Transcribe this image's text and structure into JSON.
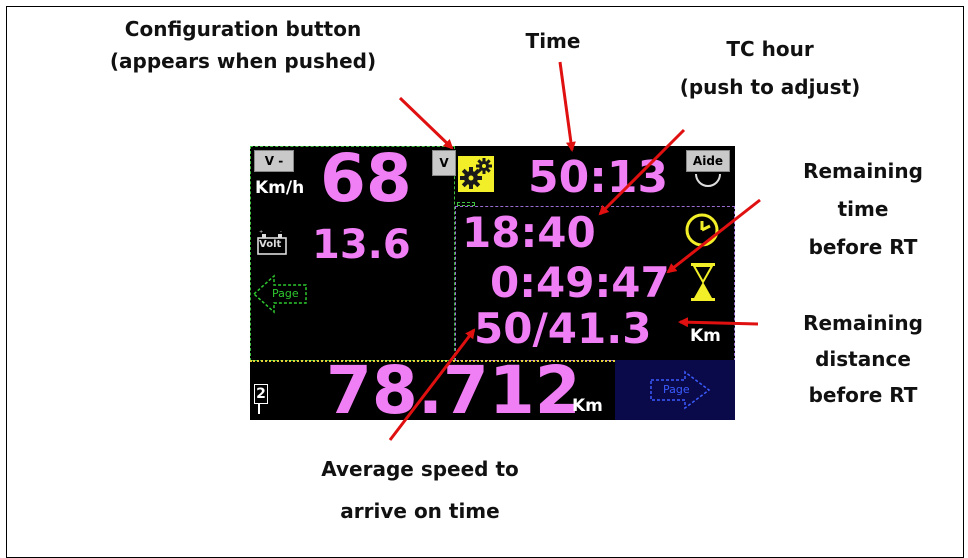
{
  "annotations": {
    "config_line1": "Configuration button",
    "config_line2": "(appears when pushed)",
    "time": "Time",
    "tc_line1": "TC hour",
    "tc_line2": "(push to adjust)",
    "remaining_time_line1": "Remaining",
    "remaining_time_line2": "time",
    "remaining_time_line3": "before RT",
    "remaining_dist_line1": "Remaining",
    "remaining_dist_line2": "distance",
    "remaining_dist_line3": "before RT",
    "avg_line1": "Average speed to",
    "avg_line2": "arrive on time"
  },
  "device": {
    "v_minus_label": "V -",
    "v_label": "V",
    "aide_label": "Aide",
    "speed_value": "68",
    "speed_unit": "Km/h",
    "volt_label": "Volt",
    "volt_value": "13.6",
    "page_left_label": "Page",
    "time_value": "50:13",
    "tc_hour": "18:40",
    "remaining_time": "0:49:47",
    "avg_remaining": "50/41.3",
    "km_unit_right": "Km",
    "odometer_index": "2",
    "odometer_value": "78.712",
    "km_unit_bottom": "Km",
    "page_right_label": "Page"
  },
  "colors": {
    "accent": "#f07ef4",
    "gear_bg": "#f2ef28",
    "arrow": "#e01010",
    "screen_bg": "#000000",
    "page_right_bg": "#0a0a4a"
  }
}
